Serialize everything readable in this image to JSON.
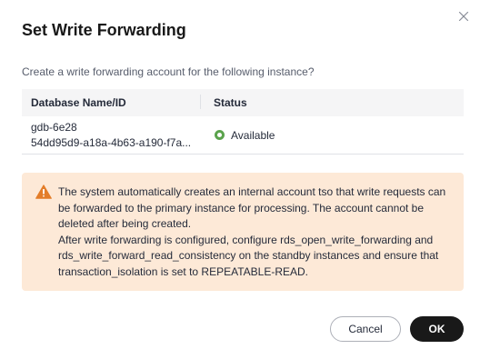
{
  "dialog": {
    "title": "Set Write Forwarding",
    "description": "Create a write forwarding account for the following instance?"
  },
  "table": {
    "headers": {
      "name": "Database Name/ID",
      "status": "Status"
    },
    "rows": [
      {
        "name": "gdb-6e28",
        "id": "54dd95d9-a18a-4b63-a190-f7a...",
        "status": "Available",
        "status_color": "#5ba34d"
      }
    ]
  },
  "notice": {
    "icon": "warning-icon",
    "accent_color": "#e37d29",
    "background": "#fde9d7",
    "lines": [
      "The system automatically creates an internal account tso that write requests can be forwarded to the primary instance for processing. The account cannot be deleted after being created.",
      "After write forwarding is configured, configure rds_open_write_forwarding and rds_write_forward_read_consistency on the standby instances and ensure that transaction_isolation is set to REPEATABLE-READ."
    ]
  },
  "buttons": {
    "cancel": "Cancel",
    "ok": "OK"
  }
}
